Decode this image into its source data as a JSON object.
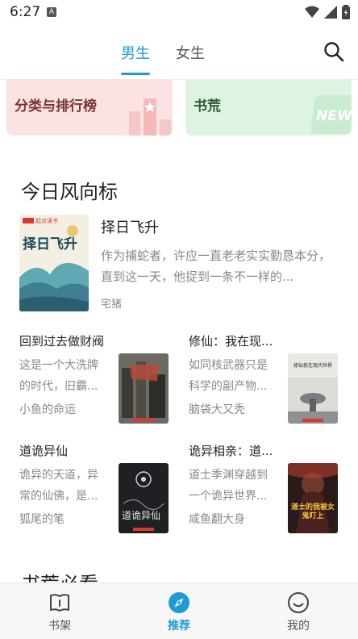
{
  "status_bar": {
    "time": "6:27",
    "app_indicator": "A"
  },
  "tabs": [
    {
      "label": "男生",
      "active": true
    },
    {
      "label": "女生",
      "active": false
    }
  ],
  "categories": [
    {
      "label": "分类与排行榜"
    },
    {
      "label": "书荒",
      "badge": "NEW"
    }
  ],
  "section": {
    "title": "今日风向标"
  },
  "featured": {
    "title": "择日飞升",
    "description": "作为捕蛇者，许应一直老老实实勤恳本分，直到这一天，他捉到一条不一样的...",
    "author": "宅猪",
    "cover_badge": "起点读书",
    "cover_title": "择日飞升"
  },
  "books": [
    {
      "title": "回到过去做财阀",
      "description": "这是一个大洗牌的时代，旧霸...",
      "author": "小鱼的命运"
    },
    {
      "title": "修仙：我在现...",
      "description": "如同核武器只是科学的副产物...",
      "author": "脑袋大又秃",
      "cover_title": "修仙我在现代世界"
    },
    {
      "title": "道诡异仙",
      "description": "诡异的天道，异常的仙佛，是...",
      "author": "狐尾的笔",
      "cover_title": "道诡异仙"
    },
    {
      "title": "诡异相亲：道...",
      "description": "道士季渊穿越到一个诡异世界...",
      "author": "咸鱼翻大身",
      "cover_title": "道士的我被女鬼盯上"
    }
  ],
  "next_section": {
    "title": "书荒必看"
  },
  "bottom_nav": [
    {
      "label": "书架",
      "icon": "bookshelf-icon",
      "active": false
    },
    {
      "label": "推荐",
      "icon": "compass-icon",
      "active": true
    },
    {
      "label": "我的",
      "icon": "smiley-icon",
      "active": false
    }
  ],
  "colors": {
    "accent": "#1e9bd7",
    "card_pink": "#fbe3e3",
    "card_green": "#dff3e2"
  }
}
